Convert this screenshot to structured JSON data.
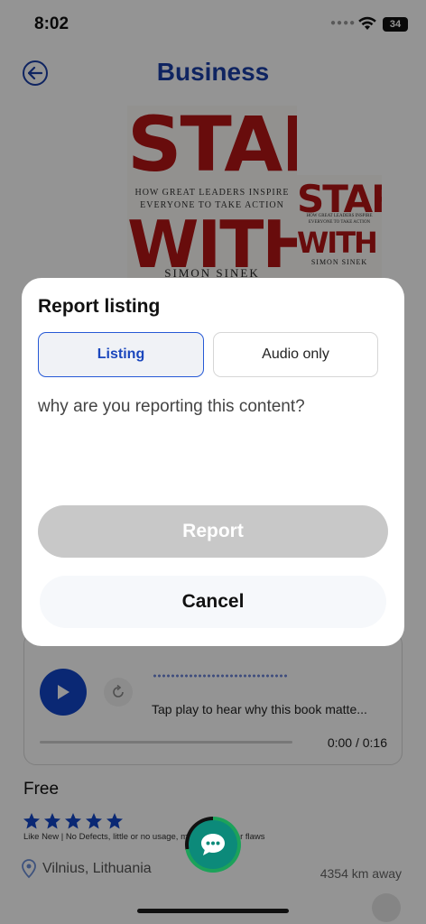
{
  "status_bar": {
    "time": "8:02",
    "battery": "34"
  },
  "header": {
    "title": "Business"
  },
  "book": {
    "title_line1": "START",
    "subtitle": "HOW GREAT LEADERS INSPIRE EVERYONE TO TAKE ACTION",
    "title_line2": "WITH",
    "author": "SIMON SINEK"
  },
  "audio": {
    "hint": "Tap play to hear why this book matte...",
    "time": "0:00 / 0:16"
  },
  "listing": {
    "price": "Free",
    "rating": 5,
    "condition": "Like New | No Defects, little or no usage, may show minor flaws",
    "location": "Vilnius, Lithuania",
    "distance": "4354 km away"
  },
  "modal": {
    "title": "Report listing",
    "tabs": [
      "Listing",
      "Audio only"
    ],
    "selected_tab": "Listing",
    "question": "why are you reporting this content?",
    "report_label": "Report",
    "cancel_label": "Cancel"
  },
  "colors": {
    "accent": "#1a3fa8",
    "play_button": "#1246c9",
    "cover_red": "#b31515",
    "disabled_button": "#c8c8c8"
  },
  "icons": {
    "back": "back-arrow-icon",
    "play": "play-icon",
    "replay": "replay-icon",
    "star": "star-icon",
    "location": "location-pin-icon",
    "chat": "chat-bubble-icon"
  }
}
